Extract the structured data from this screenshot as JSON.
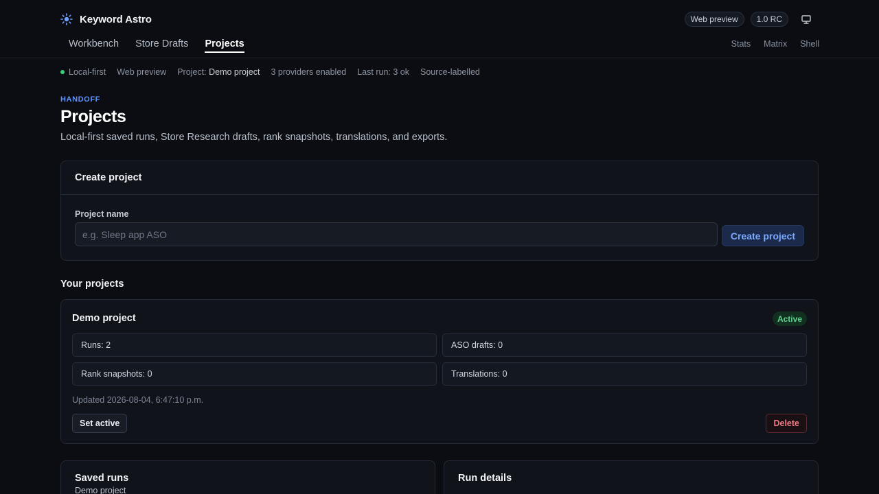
{
  "app": {
    "name": "Keyword Astro",
    "pills": [
      "Web preview",
      "1.0 RC"
    ],
    "icons": {
      "logo": "sun-icon",
      "display": "monitor-icon"
    }
  },
  "nav": {
    "tabs": [
      {
        "label": "Workbench",
        "active": false
      },
      {
        "label": "Store Drafts",
        "active": false
      },
      {
        "label": "Projects",
        "active": true
      }
    ],
    "right": [
      "Stats",
      "Matrix",
      "Shell"
    ]
  },
  "status": {
    "local": "Local-first",
    "preview": "Web preview",
    "project_prefix": "Project:",
    "project_name": "Demo project",
    "providers": "3 providers enabled",
    "last_run": "Last run: 3 ok",
    "source": "Source-labelled"
  },
  "page": {
    "eyebrow": "HANDOFF",
    "title": "Projects",
    "subtitle": "Local-first saved runs, Store Research drafts, rank snapshots, translations, and exports."
  },
  "create": {
    "title": "Create project",
    "field_label": "Project name",
    "placeholder": "e.g. Sleep app ASO",
    "button": "Create project"
  },
  "projects": {
    "section_title": "Your projects",
    "items": [
      {
        "name": "Demo project",
        "badge": "Active",
        "stats": {
          "runs": "Runs: 2",
          "aso_drafts": "ASO drafts: 0",
          "rank_snapshots": "Rank snapshots: 0",
          "translations": "Translations: 0"
        },
        "updated": "Updated 2026-08-04, 6:47:10 p.m.",
        "set_active": "Set active",
        "delete": "Delete"
      }
    ]
  },
  "saved_runs": {
    "title": "Saved runs",
    "subtitle": "Demo project"
  },
  "run_details": {
    "title": "Run details"
  },
  "colors": {
    "accent": "#5f93ff",
    "success": "#3ecf7a",
    "danger": "#f07c86",
    "background": "#0b0d12"
  }
}
